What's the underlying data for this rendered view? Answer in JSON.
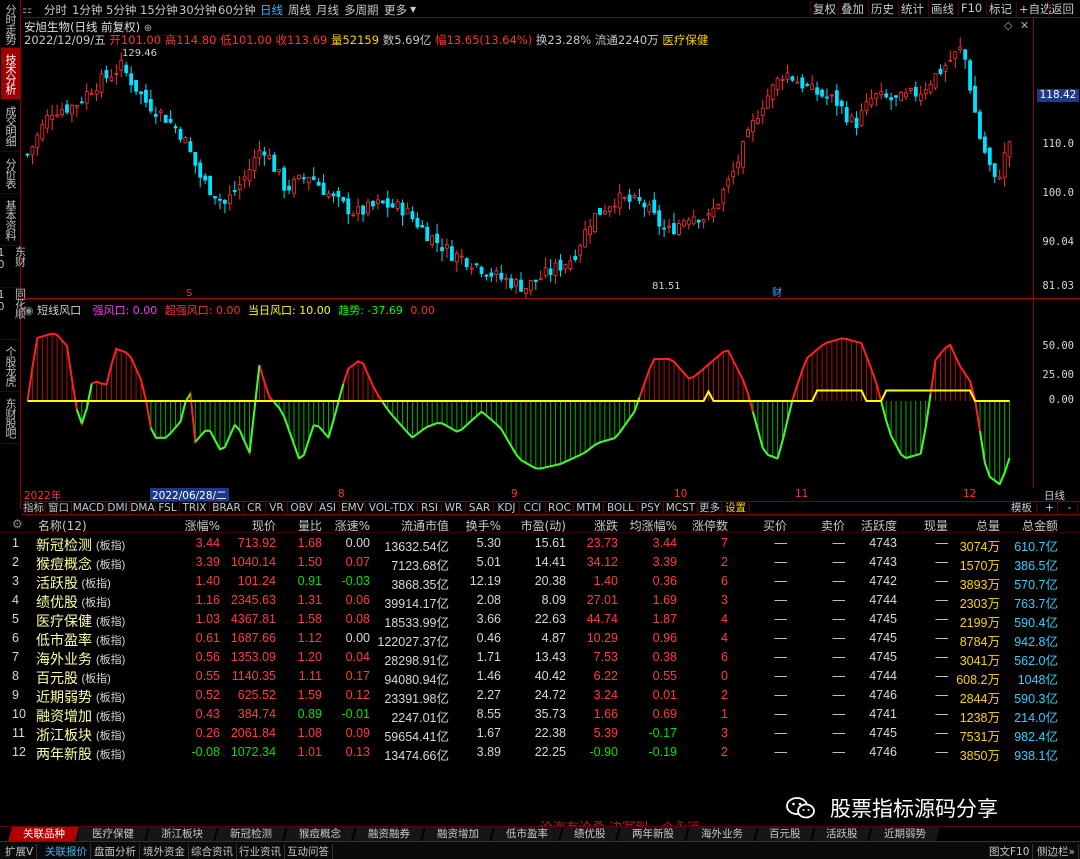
{
  "left_tabs": [
    "分时走势",
    "技术分析",
    "成交明细",
    "分价表",
    "基本资料",
    "东财10",
    "同花顺10",
    "个股龙虎",
    "东财股吧"
  ],
  "left_tab_active": 1,
  "timeframes": [
    "分时",
    "1分钟",
    "5分钟",
    "15分钟",
    "30分钟",
    "60分钟",
    "日线",
    "周线",
    "月线",
    "多周期",
    "更多"
  ],
  "timeframe_active": 6,
  "toolbar_buttons": [
    "复权",
    "叠加",
    "历史",
    "统计",
    "画线",
    "F10",
    "标记",
    "+自选",
    "返回"
  ],
  "stock": {
    "title": "安旭生物(日线 前复权)",
    "date": "2022/12/09/五",
    "open": "开101.00",
    "high": "高114.80",
    "low": "低101.00",
    "close": "收113.69",
    "volume": "量52159",
    "amount": "数5.69亿",
    "change": "幅13.65(13.64%)",
    "turnover": "换23.28%",
    "float": "流通2240万",
    "sector": "医疗保健"
  },
  "price_axis": {
    "ticks": [
      "110.0",
      "100.0",
      "90.04",
      "81.03"
    ],
    "current": "118.42",
    "high_label": "129.46",
    "low_label": "81.51",
    "marker_s": "S",
    "marker_cai": "财"
  },
  "indicator": {
    "name": "短线风口",
    "strong": "强风口: 0.00",
    "super": "超强风口: 0.00",
    "today": "当日风口: 10.00",
    "trend": "趋势: -37.69",
    "extra": "0.00",
    "ticks": [
      "50.00",
      "25.00",
      "0.00"
    ]
  },
  "date_axis": [
    "2022年",
    "2022/06/28/二",
    "8",
    "9",
    "10",
    "11",
    "12",
    "日线"
  ],
  "indicator_tabs": [
    "指标",
    "窗口",
    "MACD",
    "DMI",
    "DMA",
    "FSL",
    "TRIX",
    "BRAR",
    "CR",
    "VR",
    "OBV",
    "ASI",
    "EMV",
    "VOL-TDX",
    "RSI",
    "WR",
    "SAR",
    "KDJ",
    "CCI",
    "ROC",
    "MTM",
    "BOLL",
    "PSY",
    "MCST",
    "更多",
    "设置"
  ],
  "indicator_tab_active": 25,
  "indicator_right": [
    "模板",
    "+",
    "-"
  ],
  "table": {
    "headers": [
      "名称(12)",
      "涨幅%",
      "现价",
      "量比",
      "涨速%",
      "流通市值",
      "换手%",
      "市盈(动)",
      "涨跌",
      "均涨幅%",
      "涨停数",
      "买价",
      "卖价",
      "活跃度",
      "现量",
      "总量",
      "总金额"
    ],
    "rows": [
      [
        "1",
        "新冠检测",
        "(板指)",
        "3.44",
        "713.92",
        "1.68",
        "0.00",
        "13632.54亿",
        "5.30",
        "15.61",
        "23.73",
        "3.44",
        "7",
        "—",
        "—",
        "4743",
        "—",
        "3074万",
        "610.7亿"
      ],
      [
        "2",
        "猴痘概念",
        "(板指)",
        "3.39",
        "1040.14",
        "1.50",
        "0.07",
        "7123.68亿",
        "5.01",
        "14.41",
        "34.12",
        "3.39",
        "2",
        "—",
        "—",
        "4743",
        "—",
        "1570万",
        "386.5亿"
      ],
      [
        "3",
        "活跃股",
        "(板指)",
        "1.40",
        "101.24",
        "0.91",
        "-0.03",
        "3868.35亿",
        "12.19",
        "20.38",
        "1.40",
        "0.36",
        "6",
        "—",
        "—",
        "4742",
        "—",
        "3893万",
        "570.7亿"
      ],
      [
        "4",
        "绩优股",
        "(板指)",
        "1.16",
        "2345.63",
        "1.31",
        "0.06",
        "39914.17亿",
        "2.08",
        "8.09",
        "27.01",
        "1.69",
        "3",
        "—",
        "—",
        "4744",
        "—",
        "2303万",
        "763.7亿"
      ],
      [
        "5",
        "医疗保健",
        "(板指)",
        "1.03",
        "4367.81",
        "1.58",
        "0.08",
        "18533.99亿",
        "3.66",
        "22.63",
        "44.74",
        "1.87",
        "4",
        "—",
        "—",
        "4745",
        "—",
        "2199万",
        "590.4亿"
      ],
      [
        "6",
        "低市盈率",
        "(板指)",
        "0.61",
        "1687.66",
        "1.12",
        "0.00",
        "122027.37亿",
        "0.46",
        "4.87",
        "10.29",
        "0.96",
        "4",
        "—",
        "—",
        "4745",
        "—",
        "8784万",
        "942.8亿"
      ],
      [
        "7",
        "海外业务",
        "(板指)",
        "0.56",
        "1353.09",
        "1.20",
        "0.04",
        "28298.91亿",
        "1.71",
        "13.43",
        "7.53",
        "0.38",
        "6",
        "—",
        "—",
        "4745",
        "—",
        "3041万",
        "562.0亿"
      ],
      [
        "8",
        "百元股",
        "(板指)",
        "0.55",
        "1140.35",
        "1.11",
        "0.17",
        "94080.94亿",
        "1.46",
        "40.42",
        "6.22",
        "0.55",
        "0",
        "—",
        "—",
        "4744",
        "—",
        "608.2万",
        "1048亿"
      ],
      [
        "9",
        "近期弱势",
        "(板指)",
        "0.52",
        "625.52",
        "1.59",
        "0.12",
        "23391.98亿",
        "2.27",
        "24.72",
        "3.24",
        "0.01",
        "2",
        "—",
        "—",
        "4746",
        "—",
        "2844万",
        "590.3亿"
      ],
      [
        "10",
        "融资增加",
        "(板指)",
        "0.43",
        "384.74",
        "0.89",
        "-0.01",
        "2247.01亿",
        "8.55",
        "35.73",
        "1.66",
        "0.69",
        "1",
        "—",
        "—",
        "4741",
        "—",
        "1238万",
        "214.0亿"
      ],
      [
        "11",
        "浙江板块",
        "(板指)",
        "0.26",
        "2061.84",
        "1.08",
        "0.09",
        "59654.41亿",
        "1.67",
        "22.38",
        "5.39",
        "-0.17",
        "3",
        "—",
        "—",
        "4745",
        "—",
        "7531万",
        "982.4亿"
      ],
      [
        "12",
        "两年新股",
        "(板指)",
        "-0.08",
        "1072.34",
        "1.01",
        "0.13",
        "13474.66亿",
        "3.89",
        "22.25",
        "-0.90",
        "-0.19",
        "2",
        "—",
        "—",
        "4746",
        "—",
        "3850万",
        "938.1亿"
      ]
    ]
  },
  "bottom_tabs": [
    "关联品种",
    "医疗保健",
    "浙江板块",
    "新冠检测",
    "猴痘概念",
    "融资融券",
    "融资增加",
    "低市盈率",
    "绩优股",
    "两年新股",
    "海外业务",
    "百元股",
    "活跃股",
    "近期弱势"
  ],
  "bottom_tab_active": 0,
  "status_items": [
    "扩展V",
    "关联报价",
    "盘面分析",
    "境外资金",
    "综合资讯",
    "行业资讯",
    "互动问答"
  ],
  "status_active": 1,
  "status_right": [
    "图文F10",
    "侧边栏»"
  ],
  "watermark": "股票指标源码分享",
  "overlay": "沧海有沧桑 边写到一个永远"
}
